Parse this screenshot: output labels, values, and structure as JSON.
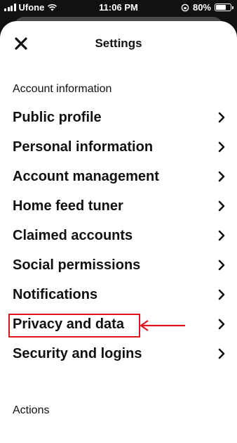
{
  "status_bar": {
    "carrier": "Ufone",
    "time": "11:06 PM",
    "battery": "80%",
    "battery_level": 0.8
  },
  "header": {
    "title": "Settings",
    "close_icon": "close-icon"
  },
  "sections": {
    "account_info_label": "Account information",
    "actions_label": "Actions"
  },
  "menu": {
    "items": [
      {
        "label": "Public profile"
      },
      {
        "label": "Personal information"
      },
      {
        "label": "Account management"
      },
      {
        "label": "Home feed tuner"
      },
      {
        "label": "Claimed accounts"
      },
      {
        "label": "Social permissions"
      },
      {
        "label": "Notifications"
      },
      {
        "label": "Privacy and data"
      },
      {
        "label": "Security and logins"
      }
    ]
  },
  "annotation": {
    "highlight_color": "#e0161e",
    "highlighted_item": "Privacy and data"
  }
}
